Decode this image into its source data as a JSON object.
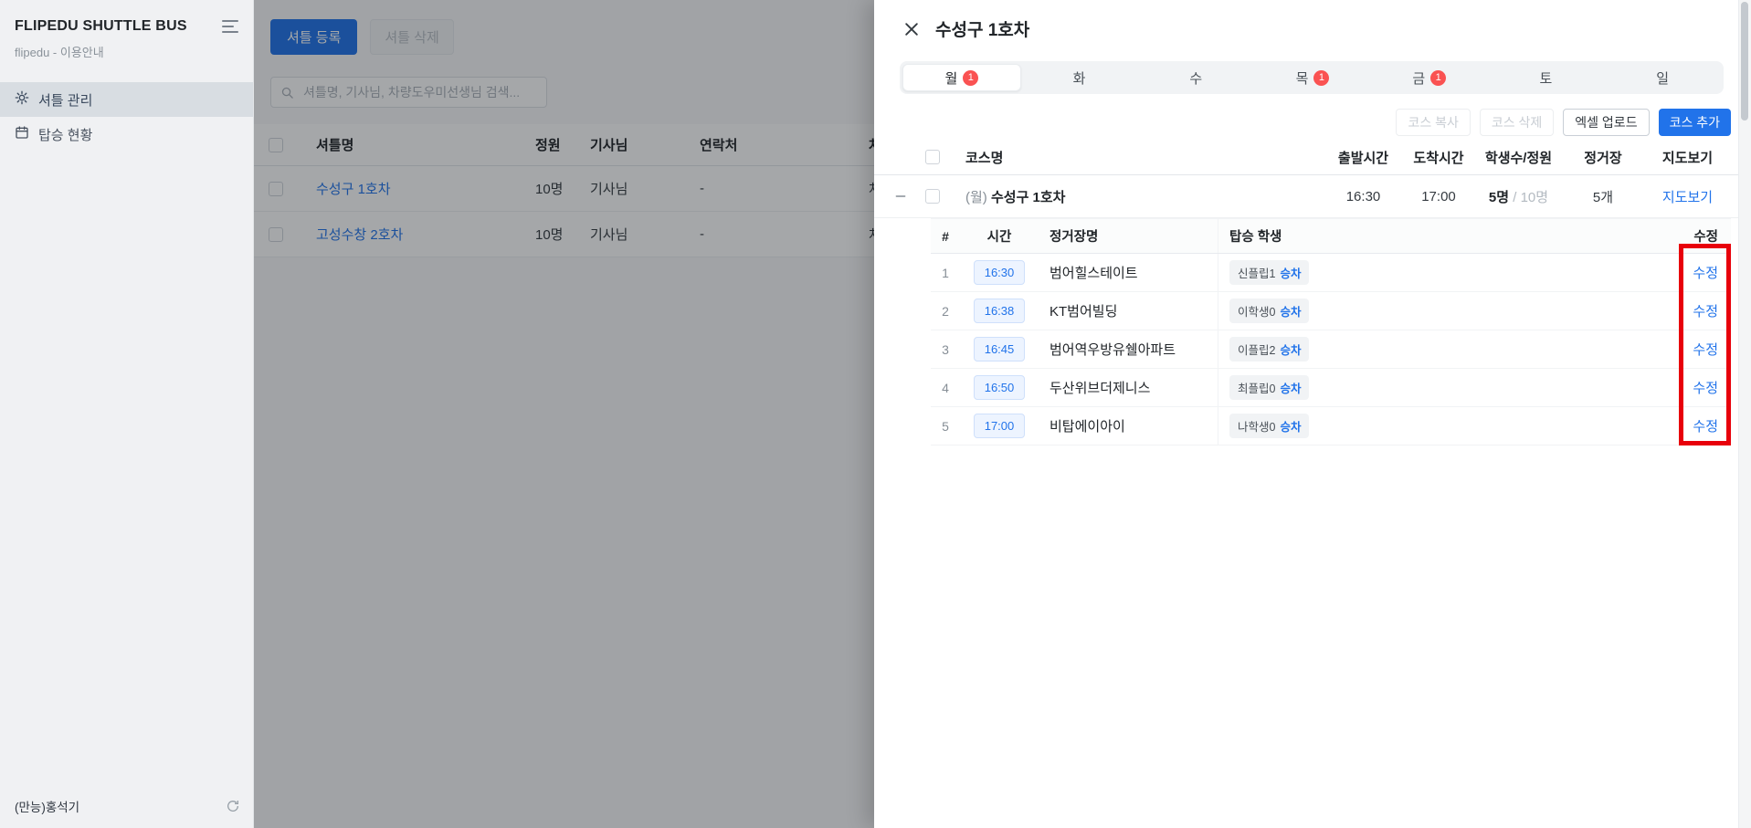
{
  "colors": {
    "accent": "#2173ea",
    "badge_red": "#fa5252",
    "annotation_red": "#e8000b"
  },
  "sidebar": {
    "title": "FLIPEDU SHUTTLE BUS",
    "subtitle": "flipedu - 이용안내",
    "items": [
      {
        "label": "셔틀 관리"
      },
      {
        "label": "탑승 현황"
      }
    ],
    "footer": "(만능)홍석기"
  },
  "main": {
    "register_button": "셔틀 등록",
    "delete_button": "셔틀 삭제",
    "search_placeholder": "셔틀명, 기사님, 차량도우미선생님 검색...",
    "table": {
      "headers": {
        "name": "셔틀명",
        "capacity": "정원",
        "driver": "기사님",
        "contact": "연락처",
        "vehicle": "차량"
      },
      "rows": [
        {
          "name": "수성구 1호차",
          "capacity": "10명",
          "driver": "기사님",
          "contact": "-",
          "vehicle": "차량"
        },
        {
          "name": "고성수창 2호차",
          "capacity": "10명",
          "driver": "기사님",
          "contact": "-",
          "vehicle": "차량"
        }
      ]
    }
  },
  "drawer": {
    "title": "수성구 1호차",
    "days": [
      {
        "label": "월",
        "badge": "1"
      },
      {
        "label": "화"
      },
      {
        "label": "수"
      },
      {
        "label": "목",
        "badge": "1"
      },
      {
        "label": "금",
        "badge": "1"
      },
      {
        "label": "토"
      },
      {
        "label": "일"
      }
    ],
    "actions": {
      "copy": "코스 복사",
      "remove": "코스 삭제",
      "excel": "엑셀 업로드",
      "add": "코스 추가"
    },
    "course_table": {
      "headers": {
        "name": "코스명",
        "depart": "출발시간",
        "arrive": "도착시간",
        "students": "학생수/정원",
        "stops": "정거장",
        "map": "지도보기"
      },
      "course": {
        "day_prefix": "(월)",
        "name": "수성구 1호차",
        "depart": "16:30",
        "arrive": "17:00",
        "student_count": "5명",
        "capacity_suffix": " / 10명",
        "stops": "5개",
        "map_link": "지도보기"
      }
    },
    "stop_table": {
      "headers": {
        "index": "#",
        "time": "시간",
        "stop": "정거장명",
        "students": "탑승 학생",
        "edit": "수정"
      },
      "rows": [
        {
          "index": "1",
          "time": "16:30",
          "stop": "범어힐스테이트",
          "student": "신플립1",
          "board": "승차",
          "edit": "수정"
        },
        {
          "index": "2",
          "time": "16:38",
          "stop": "KT범어빌딩",
          "student": "이학생0",
          "board": "승차",
          "edit": "수정"
        },
        {
          "index": "3",
          "time": "16:45",
          "stop": "범어역우방유쉘아파트",
          "student": "이플립2",
          "board": "승차",
          "edit": "수정"
        },
        {
          "index": "4",
          "time": "16:50",
          "stop": "두산위브더제니스",
          "student": "최플립0",
          "board": "승차",
          "edit": "수정"
        },
        {
          "index": "5",
          "time": "17:00",
          "stop": "비탑에이아이",
          "student": "나학생0",
          "board": "승차",
          "edit": "수정"
        }
      ]
    }
  }
}
